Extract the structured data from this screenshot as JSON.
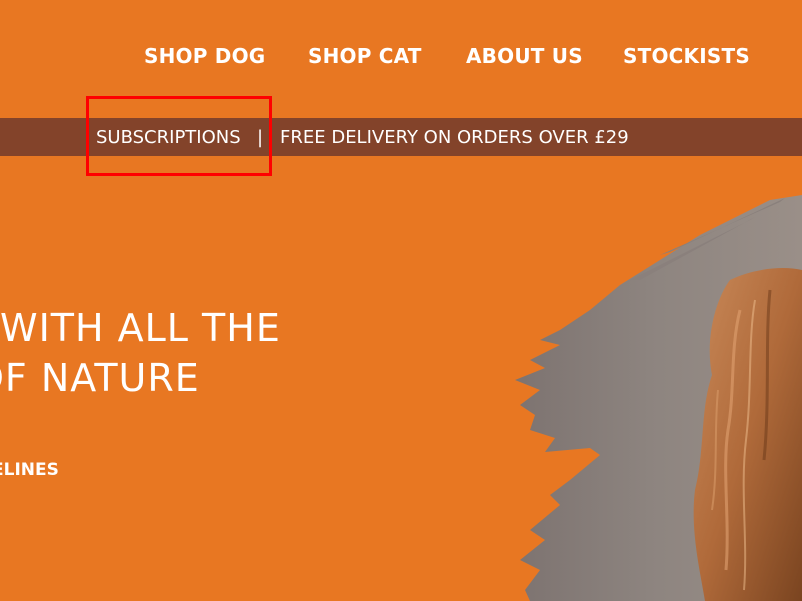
{
  "nav": {
    "items": [
      {
        "label": "SHOP DOG"
      },
      {
        "label": "SHOP CAT"
      },
      {
        "label": "ABOUT US"
      },
      {
        "label": "STOCKISTS"
      }
    ]
  },
  "announcement": {
    "subscriptions_label": "SUBSCRIPTIONS",
    "separator": "|",
    "free_delivery": "FREE DELIVERY ON ORDERS OVER £29"
  },
  "hero": {
    "line1": "WITH ALL THE",
    "line2": "OF NATURE",
    "sub": "ELINES"
  },
  "colors": {
    "background": "#e87722",
    "announcement_bar": "#83432a",
    "highlight": "#ff0000",
    "text": "#ffffff"
  }
}
